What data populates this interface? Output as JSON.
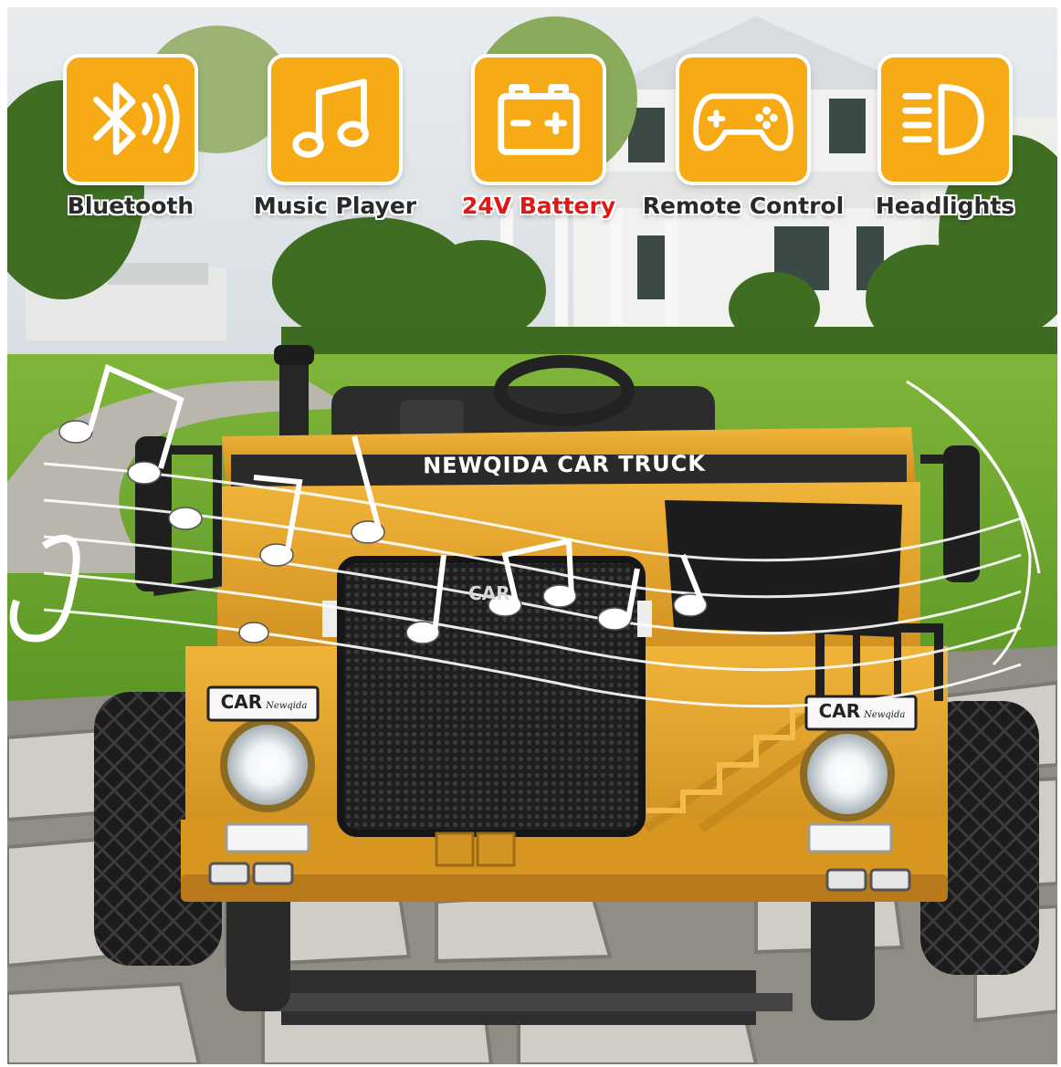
{
  "features": [
    {
      "label": "Bluetooth",
      "icon": "bluetooth-icon"
    },
    {
      "label": "Music Player",
      "icon": "music-note-icon"
    },
    {
      "label": "24V Battery",
      "icon": "battery-icon",
      "color": "#e01818"
    },
    {
      "label": "Remote Control",
      "icon": "gamepad-icon"
    },
    {
      "label": "Headlights",
      "icon": "headlight-icon"
    }
  ],
  "truck": {
    "banner_text": "NEWQIDA CAR TRUCK",
    "grille_badge": "CAR",
    "left_badge": "CAR",
    "left_badge_sub": "Newqida",
    "right_badge": "CAR",
    "right_badge_sub": "Newqida"
  },
  "colors": {
    "tile": "#f5aa16",
    "truck_body": "#e3a224",
    "accent_red": "#e01818"
  }
}
